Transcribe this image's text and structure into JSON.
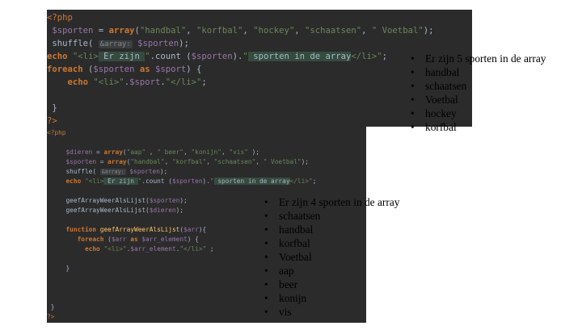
{
  "editor1": {
    "lines": [
      [
        {
          "t": "<?php",
          "c": "tag"
        }
      ],
      [
        {
          "t": " "
        },
        {
          "t": "$sporten",
          "c": "var"
        },
        {
          "t": " = "
        },
        {
          "t": "array",
          "c": "kw"
        },
        {
          "t": "("
        },
        {
          "t": "\"handbal\"",
          "c": "str"
        },
        {
          "t": ", "
        },
        {
          "t": "\"korfbal\"",
          "c": "str"
        },
        {
          "t": ", "
        },
        {
          "t": "\"hockey\"",
          "c": "str"
        },
        {
          "t": ", "
        },
        {
          "t": "\"schaatsen\"",
          "c": "str"
        },
        {
          "t": ", "
        },
        {
          "t": "\" Voetbal\"",
          "c": "str"
        },
        {
          "t": ");"
        }
      ],
      [
        {
          "t": " shuffle( "
        },
        {
          "t": "&array:",
          "c": "hint"
        },
        {
          "t": " "
        },
        {
          "t": "$sporten",
          "c": "var"
        },
        {
          "t": ");"
        }
      ],
      [
        {
          "t": "echo",
          "c": "kw"
        },
        {
          "t": " "
        },
        {
          "t": "\"<li>",
          "c": "str"
        },
        {
          "t": " Er zijn ",
          "c": "hl"
        },
        {
          "t": "\"",
          "c": "str"
        },
        {
          "t": ".count ("
        },
        {
          "t": "$sporten",
          "c": "var"
        },
        {
          "t": ")."
        },
        {
          "t": "\"",
          "c": "str"
        },
        {
          "t": " sporten in de array",
          "c": "hl"
        },
        {
          "t": "</li>\"",
          "c": "str"
        },
        {
          "t": ";"
        }
      ],
      [
        {
          "t": "foreach",
          "c": "kw"
        },
        {
          "t": " ("
        },
        {
          "t": "$sporten",
          "c": "var"
        },
        {
          "t": " "
        },
        {
          "t": "as",
          "c": "kw"
        },
        {
          "t": " "
        },
        {
          "t": "$sport",
          "c": "var"
        },
        {
          "t": ") {"
        }
      ],
      [
        {
          "t": "    "
        },
        {
          "t": "echo",
          "c": "kw"
        },
        {
          "t": " "
        },
        {
          "t": "\"<li>\"",
          "c": "str"
        },
        {
          "t": "."
        },
        {
          "t": "$sport",
          "c": "var"
        },
        {
          "t": "."
        },
        {
          "t": "\"</li>\"",
          "c": "str"
        },
        {
          "t": ";"
        }
      ],
      [],
      [
        {
          "t": " }"
        }
      ],
      [
        {
          "t": "?>",
          "c": "tag"
        }
      ]
    ]
  },
  "output1": {
    "items": [
      "Er zijn 5 sporten in de array",
      "handbal",
      "schaatsen",
      "Voetbal",
      "hockey",
      "korfbal"
    ]
  },
  "editor2": {
    "lines": [
      [
        {
          "t": "<?php",
          "c": "tag"
        }
      ],
      [],
      [
        {
          "t": "     "
        },
        {
          "t": "$dieren",
          "c": "var"
        },
        {
          "t": " = "
        },
        {
          "t": "array",
          "c": "kw"
        },
        {
          "t": "("
        },
        {
          "t": "\"aap\"",
          "c": "str"
        },
        {
          "t": " , "
        },
        {
          "t": "\" beer\"",
          "c": "str"
        },
        {
          "t": ", "
        },
        {
          "t": "\"konijn\"",
          "c": "str"
        },
        {
          "t": ", "
        },
        {
          "t": "\"vis\"",
          "c": "str"
        },
        {
          "t": " );"
        }
      ],
      [
        {
          "t": "     "
        },
        {
          "t": "$sporten",
          "c": "var"
        },
        {
          "t": " = "
        },
        {
          "t": "array",
          "c": "kw"
        },
        {
          "t": "("
        },
        {
          "t": "\"handbal\"",
          "c": "str"
        },
        {
          "t": ", "
        },
        {
          "t": "\"korfbal\"",
          "c": "str"
        },
        {
          "t": ", "
        },
        {
          "t": "\"schaatsen\"",
          "c": "str"
        },
        {
          "t": ", "
        },
        {
          "t": "\" Voetbal\"",
          "c": "str"
        },
        {
          "t": ");"
        }
      ],
      [
        {
          "t": "     shuffle( "
        },
        {
          "t": "&array:",
          "c": "hint"
        },
        {
          "t": " "
        },
        {
          "t": "$sporten",
          "c": "var"
        },
        {
          "t": ");"
        }
      ],
      [
        {
          "t": "     "
        },
        {
          "t": "echo",
          "c": "kw"
        },
        {
          "t": " "
        },
        {
          "t": "\"<li>",
          "c": "str"
        },
        {
          "t": " Er zijn ",
          "c": "hl"
        },
        {
          "t": "\"",
          "c": "str"
        },
        {
          "t": ".count ("
        },
        {
          "t": "$sporten",
          "c": "var"
        },
        {
          "t": ")."
        },
        {
          "t": "\"",
          "c": "str"
        },
        {
          "t": " sporten in de array",
          "c": "hl"
        },
        {
          "t": "</li>\"",
          "c": "str"
        },
        {
          "t": ";"
        }
      ],
      [],
      [
        {
          "t": "     geefArrayWeerAlsLijst("
        },
        {
          "t": "$sporten",
          "c": "var"
        },
        {
          "t": ");"
        }
      ],
      [
        {
          "t": "     geefArrayWeerAlsLijst("
        },
        {
          "t": "$dieren",
          "c": "var"
        },
        {
          "t": ");"
        }
      ],
      [],
      [
        {
          "t": "     "
        },
        {
          "t": "function",
          "c": "kw"
        },
        {
          "t": " "
        },
        {
          "t": "geefArrayWeerAlsLijst",
          "c": "fn"
        },
        {
          "t": "("
        },
        {
          "t": "$arr",
          "c": "var"
        },
        {
          "t": "){"
        }
      ],
      [
        {
          "t": "        "
        },
        {
          "t": "foreach",
          "c": "kw"
        },
        {
          "t": " ("
        },
        {
          "t": "$arr",
          "c": "var"
        },
        {
          "t": " "
        },
        {
          "t": "as",
          "c": "kw"
        },
        {
          "t": " "
        },
        {
          "t": "$arr_element",
          "c": "var"
        },
        {
          "t": ") {"
        }
      ],
      [
        {
          "t": "          "
        },
        {
          "t": "echo",
          "c": "kw"
        },
        {
          "t": " "
        },
        {
          "t": "\"<li>\"",
          "c": "str"
        },
        {
          "t": "."
        },
        {
          "t": "$arr_element",
          "c": "var"
        },
        {
          "t": "."
        },
        {
          "t": "\"</li>\"",
          "c": "str"
        },
        {
          "t": " ;"
        }
      ],
      [],
      [
        {
          "t": "     }"
        }
      ],
      [],
      [],
      [],
      [
        {
          "t": " }"
        }
      ],
      [
        {
          "t": "?>",
          "c": "tag"
        }
      ]
    ]
  },
  "output2": {
    "items": [
      "Er zijn 4 sporten in de array",
      "schaatsen",
      "handbal",
      "korfbal",
      "Voetbal",
      "aap",
      "beer",
      "konijn",
      "vis"
    ]
  }
}
